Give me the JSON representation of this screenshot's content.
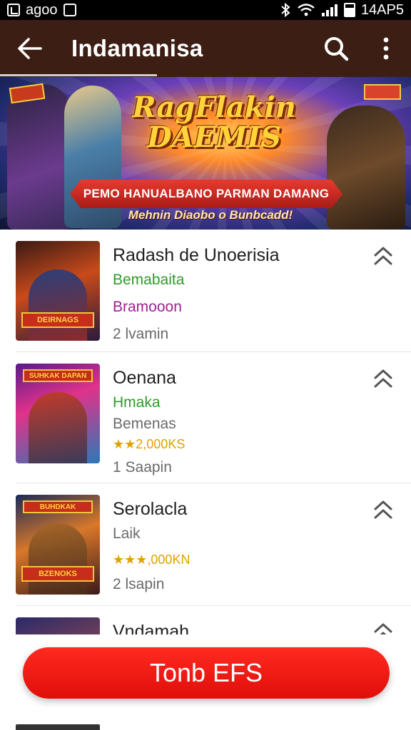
{
  "status_bar": {
    "app_label": "agoo",
    "time": "14AP5"
  },
  "app_bar": {
    "title": "Indamanisa",
    "back_icon": "arrow-left-icon",
    "search_icon": "search-icon",
    "menu_icon": "more-vertical-icon"
  },
  "banner": {
    "title_line1": "RagFlakin",
    "title_line2": "DAEMIS",
    "ribbon": "PEMO HANUALBANO PARMAN DAMANG",
    "subtitle": "Mehnin Diaobo o Bunbcadd!"
  },
  "list": {
    "items": [
      {
        "title": "Radash de Unoerisia",
        "line1": "Bemabaita",
        "line2": "Bramooon",
        "meta": "2 lvamin",
        "thumb_label": "DEIRNAGS",
        "thumb_top": ""
      },
      {
        "title": "Oenana",
        "line1": "Hmaka",
        "line2": "Bemenas",
        "rating": "★★2,000KS",
        "meta": "1 Saapin",
        "thumb_label": "",
        "thumb_top": "SUHKAK DAPAN"
      },
      {
        "title": "Serolacla",
        "line1": "Laik",
        "rating": "★★★,000KN",
        "meta": "2 lsapin",
        "thumb_label": "BZENOKS",
        "thumb_top": "BUHDKAK"
      },
      {
        "title": "Vndamah"
      }
    ]
  },
  "cta": {
    "label": "Tonb EFS"
  },
  "colors": {
    "app_bar": "#3c1e14",
    "cta": "#f0140e",
    "green_text": "#2f9a2b",
    "magenta_text": "#a02090",
    "rating": "#e0a100"
  }
}
